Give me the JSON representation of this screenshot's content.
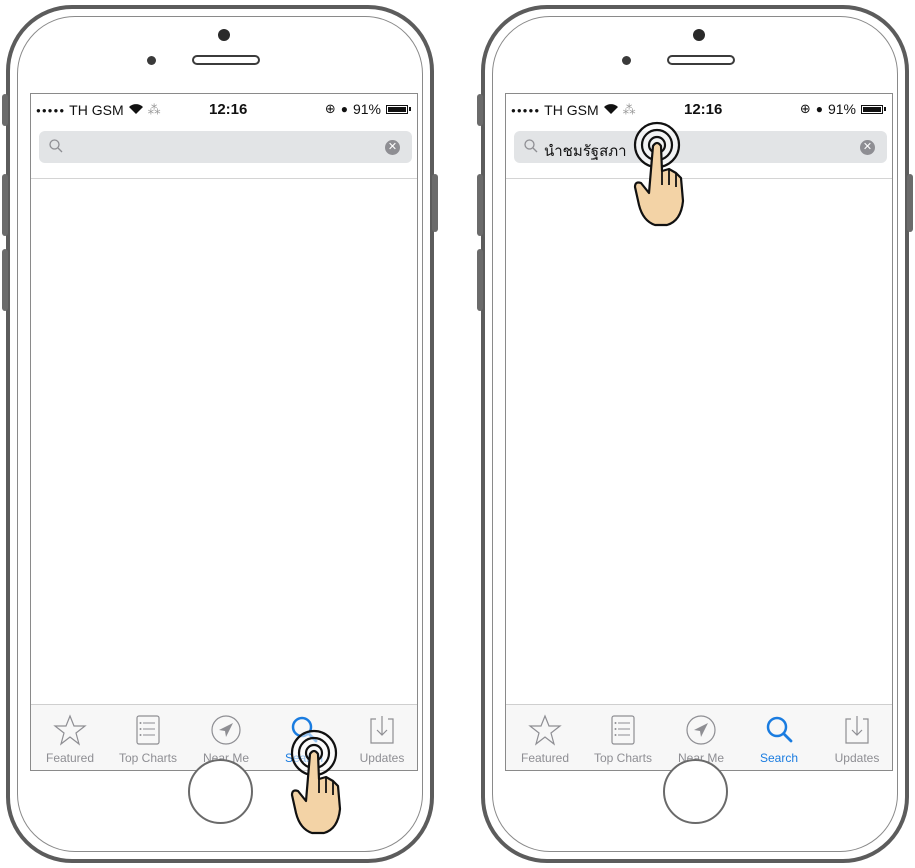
{
  "status": {
    "carrier": "TH GSM",
    "time": "12:16",
    "battery": "91%",
    "battery_level": 0.91
  },
  "search": {
    "placeholder": "",
    "query": "นำชมรัฐสภา"
  },
  "tabs": [
    {
      "label": "Featured",
      "icon": "star-icon"
    },
    {
      "label": "Top Charts",
      "icon": "list-icon"
    },
    {
      "label": "Near Me",
      "icon": "location-icon"
    },
    {
      "label": "Search",
      "icon": "search-icon"
    },
    {
      "label": "Updates",
      "icon": "updates-icon"
    }
  ],
  "colors": {
    "active_tab": "#1a7ce0",
    "inactive_tab": "#8e8e93"
  }
}
